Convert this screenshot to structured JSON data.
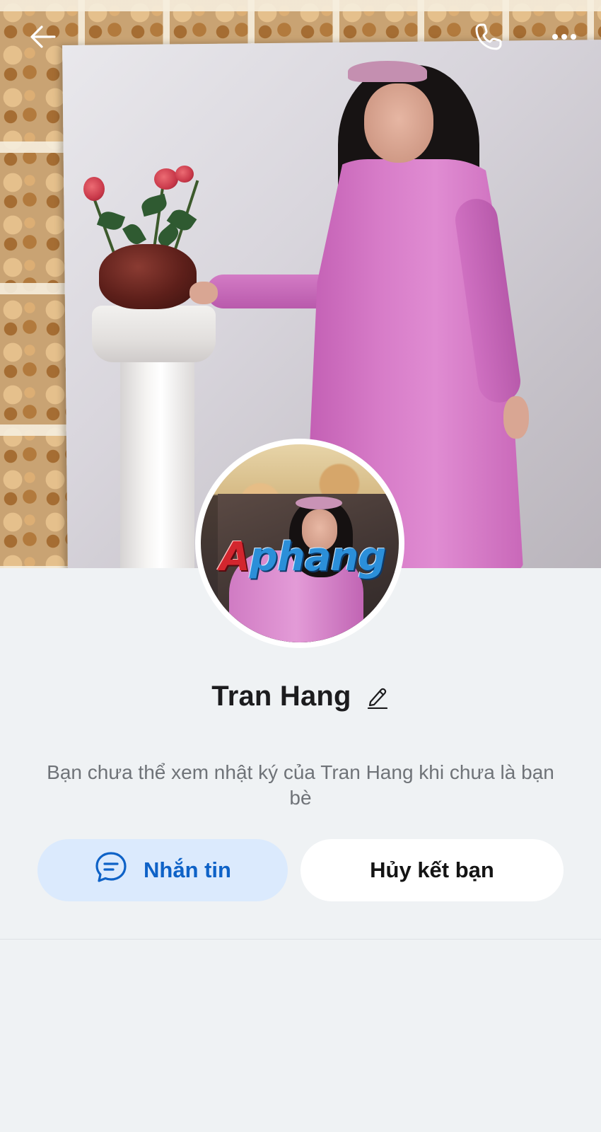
{
  "header": {
    "back_icon": "arrow-left-icon",
    "call_icon": "phone-icon",
    "more_icon": "more-horizontal-icon"
  },
  "cover": {
    "description": "cover-photo"
  },
  "avatar": {
    "watermark_first": "A",
    "watermark_rest": "phang"
  },
  "profile": {
    "name": "Tran Hang",
    "edit_icon": "pencil-icon",
    "notice": "Bạn chưa thể xem nhật ký của Tran Hang khi chưa là bạn bè"
  },
  "actions": {
    "message_label": "Nhắn tin",
    "message_icon": "chat-bubble-icon",
    "unfriend_label": "Hủy kết bạn"
  },
  "colors": {
    "background": "#eff2f4",
    "primary": "#0e62c7",
    "primary_soft": "#dbeafd",
    "text": "#1c1c1e",
    "muted": "#6f7378"
  }
}
